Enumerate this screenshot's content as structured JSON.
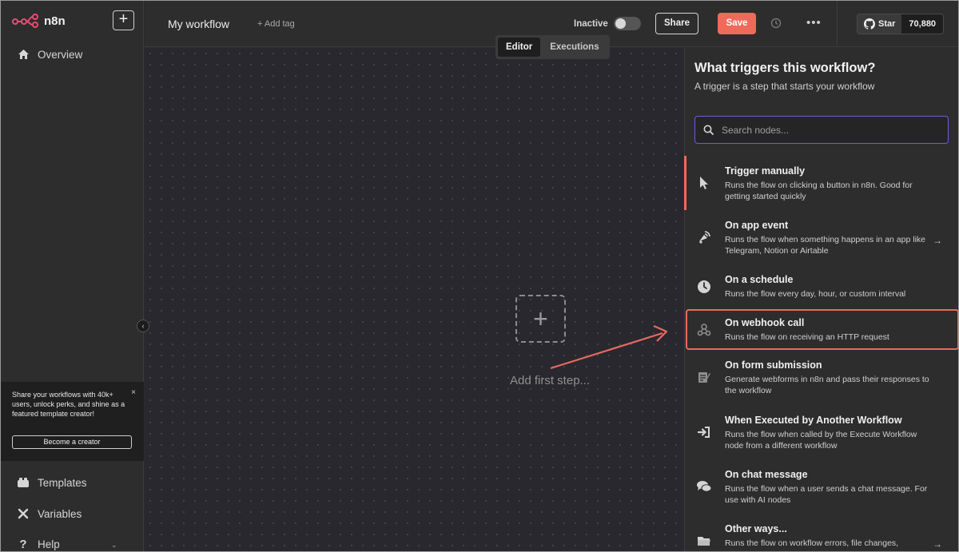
{
  "app": {
    "logo_text": "n8n"
  },
  "sidebar": {
    "new_button": "+",
    "overview": "Overview",
    "promo": {
      "text": "Share your workflows with 40k+ users, unlock perks, and shine as a featured template creator!",
      "close": "×",
      "button": "Become a creator"
    },
    "collapse": "‹",
    "templates": "Templates",
    "variables": "Variables",
    "help": "Help",
    "help_chevron": "⌄"
  },
  "header": {
    "workflow_name": "My workflow",
    "add_tag": "+ Add tag",
    "status": "Inactive",
    "share": "Share",
    "save": "Save",
    "more": "•••",
    "github": {
      "star": "Star",
      "count": "70,880"
    }
  },
  "canvas": {
    "tabs": [
      {
        "label": "Editor",
        "active": true
      },
      {
        "label": "Executions",
        "active": false
      }
    ],
    "add_icon": "+",
    "add_label": "Add first step..."
  },
  "panel": {
    "title": "What triggers this workflow?",
    "subtitle": "A trigger is a step that starts your workflow",
    "search_placeholder": "Search nodes...",
    "items": [
      {
        "title": "Trigger manually",
        "desc": "Runs the flow on clicking a button in n8n. Good for getting started quickly",
        "icon": "cursor-icon"
      },
      {
        "title": "On app event",
        "desc": "Runs the flow when something happens in an app like Telegram, Notion or Airtable",
        "icon": "app-event-icon",
        "arrow": "→"
      },
      {
        "title": "On a schedule",
        "desc": "Runs the flow every day, hour, or custom interval",
        "icon": "clock-icon"
      },
      {
        "title": "On webhook call",
        "desc": "Runs the flow on receiving an HTTP request",
        "icon": "webhook-icon"
      },
      {
        "title": "On form submission",
        "desc": "Generate webforms in n8n and pass their responses to the workflow",
        "icon": "form-icon"
      },
      {
        "title": "When Executed by Another Workflow",
        "desc": "Runs the flow when called by the Execute Workflow node from a different workflow",
        "icon": "sign-in-icon"
      },
      {
        "title": "On chat message",
        "desc": "Runs the flow when a user sends a chat message. For use with AI nodes",
        "icon": "chat-icon"
      },
      {
        "title": "Other ways...",
        "desc": "Runs the flow on workflow errors, file changes,",
        "icon": "folder-icon",
        "arrow": "→"
      }
    ]
  },
  "colors": {
    "accent": "#ef6a5a",
    "search_border": "#6b5ce0",
    "highlight": "#e86a62"
  }
}
